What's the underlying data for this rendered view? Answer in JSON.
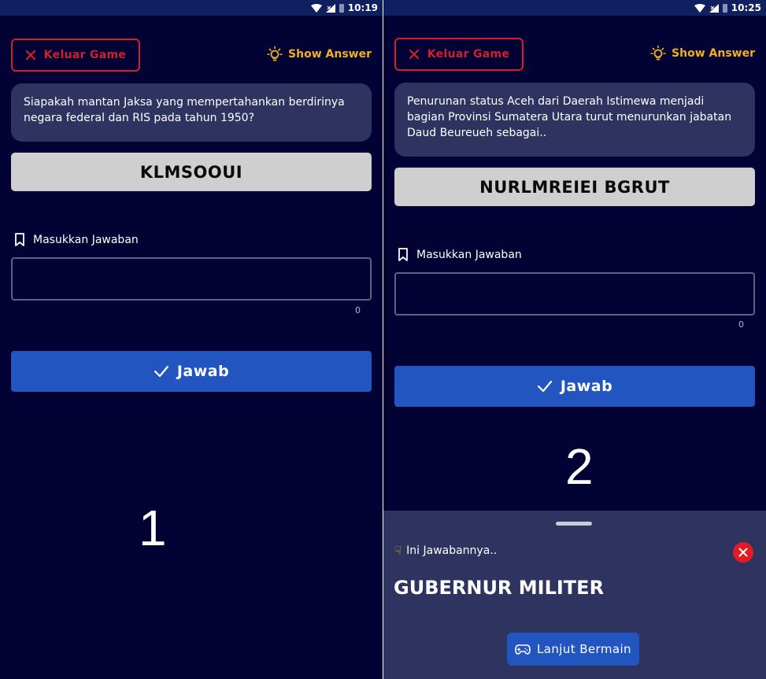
{
  "panels": [
    {
      "status_time": "10:19",
      "exit_label": "Keluar Game",
      "show_answer_label": "Show Answer",
      "question": "Siapakah mantan Jaksa yang mempertahankan berdirinya negara federal dan RIS pada tahun 1950?",
      "scrambled_word": "KLMSOOUI",
      "input_label": "Masukkan Jawaban",
      "input_value": "",
      "char_count": "0",
      "submit_label": "Jawab",
      "panel_number": "1"
    },
    {
      "status_time": "10:25",
      "exit_label": "Keluar Game",
      "show_answer_label": "Show Answer",
      "question": "Penurunan status Aceh dari Daerah Istimewa menjadi bagian Provinsi Sumatera Utara turut menurunkan jabatan Daud Beureueh sebagai..",
      "scrambled_word": "NURLMREIEI BGRUT",
      "input_label": "Masukkan Jawaban",
      "input_value": "",
      "char_count": "0",
      "submit_label": "Jawab",
      "panel_number": "2",
      "answer_sheet": {
        "title": "Ini Jawabannya..",
        "title_icon": "pointing-down-hand-icon",
        "answer": "GUBERNUR MILITER",
        "continue_label": "Lanjut Bermain",
        "continue_icon": "gamepad-icon",
        "close_icon": "close-icon"
      }
    }
  ],
  "icons": {
    "exit": "close-icon",
    "show_answer": "lightbulb-icon",
    "input_label": "bookmark-icon",
    "submit": "checkmark-icon",
    "status": [
      "wifi-icon",
      "signal-icon",
      "battery-icon"
    ]
  },
  "colors": {
    "background": "#020334",
    "status_bar": "#0f1f5f",
    "card": "#2f3360",
    "exit_red": "#d21f2c",
    "show_answer_yellow": "#f0b020",
    "primary_blue": "#2255c0",
    "scramble_box": "#cfcfcf",
    "close_red": "#e31b23"
  }
}
